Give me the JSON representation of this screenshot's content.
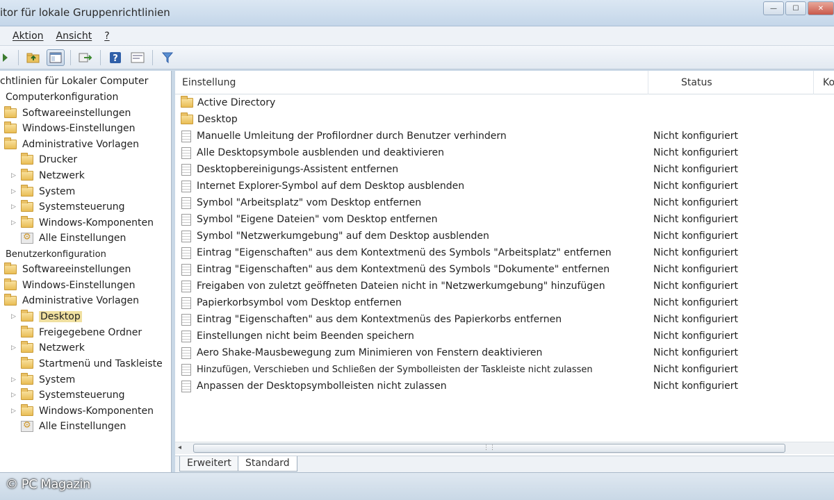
{
  "window": {
    "title": "itor für lokale Gruppenrichtlinien",
    "buttons": [
      "—",
      "☐",
      "✕"
    ]
  },
  "menu": [
    "Aktion",
    "Ansicht",
    "?"
  ],
  "toolbar": {
    "icons": [
      "back-icon",
      "folder-up-icon",
      "console-tree-icon",
      "export-icon",
      "help-icon",
      "properties-icon",
      "filter-icon"
    ]
  },
  "tree": {
    "root": "chtlinien für Lokaler Computer",
    "computer": "Computerkonfiguration",
    "computer_items": [
      "Softwareeinstellungen",
      "Windows-Einstellungen",
      "Administrative Vorlagen"
    ],
    "computer_admin_items": [
      "Drucker",
      "Netzwerk",
      "System",
      "Systemsteuerung",
      "Windows-Komponenten",
      "Alle Einstellungen"
    ],
    "user": "Benutzerkonfiguration",
    "user_items": [
      "Softwareeinstellungen",
      "Windows-Einstellungen",
      "Administrative Vorlagen"
    ],
    "user_admin_items": [
      "Desktop",
      "Freigegebene Ordner",
      "Netzwerk",
      "Startmenü und Taskleiste",
      "System",
      "Systemsteuerung",
      "Windows-Komponenten",
      "Alle Einstellungen"
    ]
  },
  "list": {
    "columns": [
      "Einstellung",
      "Status",
      "Ko"
    ],
    "folders": [
      "Active Directory",
      "Desktop"
    ],
    "rows": [
      {
        "name": "Manuelle Umleitung der Profilordner durch Benutzer verhindern",
        "status": "Nicht konfiguriert"
      },
      {
        "name": "Alle Desktopsymbole ausblenden und deaktivieren",
        "status": "Nicht konfiguriert"
      },
      {
        "name": "Desktopbereinigungs-Assistent entfernen",
        "status": "Nicht konfiguriert"
      },
      {
        "name": "Internet Explorer-Symbol auf dem Desktop ausblenden",
        "status": "Nicht konfiguriert"
      },
      {
        "name": "Symbol \"Arbeitsplatz\" vom Desktop entfernen",
        "status": "Nicht konfiguriert"
      },
      {
        "name": "Symbol \"Eigene Dateien\" vom Desktop entfernen",
        "status": "Nicht konfiguriert"
      },
      {
        "name": "Symbol \"Netzwerkumgebung\" auf dem Desktop ausblenden",
        "status": "Nicht konfiguriert"
      },
      {
        "name": "Eintrag \"Eigenschaften\" aus dem Kontextmenü des Symbols \"Arbeitsplatz\" entfernen",
        "status": "Nicht konfiguriert"
      },
      {
        "name": "Eintrag \"Eigenschaften\" aus dem Kontextmenü des Symbols \"Dokumente\" entfernen",
        "status": "Nicht konfiguriert"
      },
      {
        "name": "Freigaben von zuletzt geöffneten Dateien nicht in \"Netzwerkumgebung\" hinzufügen",
        "status": "Nicht konfiguriert"
      },
      {
        "name": "Papierkorbsymbol vom Desktop entfernen",
        "status": "Nicht konfiguriert"
      },
      {
        "name": "Eintrag \"Eigenschaften\" aus dem Kontextmenüs des Papierkorbs entfernen",
        "status": "Nicht konfiguriert"
      },
      {
        "name": "Einstellungen nicht beim Beenden speichern",
        "status": "Nicht konfiguriert"
      },
      {
        "name": "Aero Shake-Mausbewegung zum Minimieren von Fenstern deaktivieren",
        "status": "Nicht konfiguriert"
      },
      {
        "name": "Hinzufügen, Verschieben und Schließen der Symbolleisten der Taskleiste nicht zulassen",
        "status": "Nicht konfiguriert"
      },
      {
        "name": "Anpassen der Desktopsymbolleisten nicht zulassen",
        "status": "Nicht konfiguriert"
      }
    ]
  },
  "tabs": [
    "Erweitert",
    "Standard"
  ],
  "watermark": "© PC Magazin"
}
